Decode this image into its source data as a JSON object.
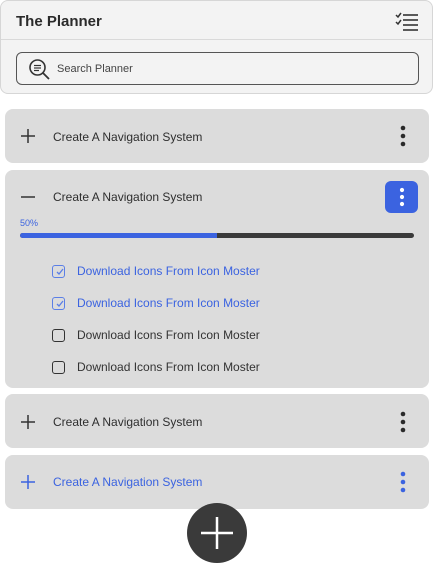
{
  "header": {
    "title": "The Planner",
    "menu_icon": "checklist-icon"
  },
  "search": {
    "placeholder": "Search Planner",
    "icon": "search-icon"
  },
  "colors": {
    "accent": "#3b63e0",
    "card_bg": "#dcdcdc",
    "dark": "#3a3a3a"
  },
  "cards": [
    {
      "label": "Create A Navigation System",
      "expanded": false
    },
    {
      "label": "Create A Navigation System",
      "expanded": true,
      "progress_text": "50%",
      "progress": 0.5,
      "tasks": [
        {
          "label": "Download Icons From Icon Moster",
          "done": true
        },
        {
          "label": "Download Icons From Icon Moster",
          "done": true
        },
        {
          "label": "Download Icons From Icon Moster",
          "done": false
        },
        {
          "label": "Download Icons From Icon Moster",
          "done": false
        }
      ]
    },
    {
      "label": "Create A Navigation System",
      "expanded": false
    },
    {
      "label": "Create A Navigation System",
      "expanded": false,
      "highlighted": true
    }
  ],
  "fab": {
    "icon": "plus-icon"
  }
}
